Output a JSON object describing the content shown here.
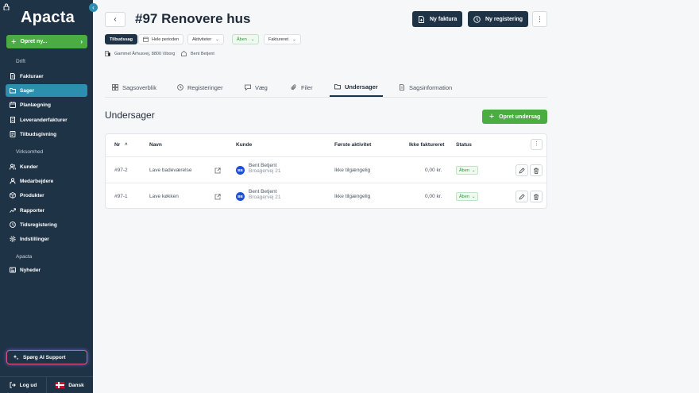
{
  "app": {
    "logo": "Apacta"
  },
  "sidebar": {
    "create_label": "Opret ny...",
    "sections": [
      {
        "label": "Drift",
        "items": [
          {
            "label": "Fakturaer",
            "icon": "invoice-icon"
          },
          {
            "label": "Sager",
            "icon": "folder-icon",
            "active": true
          },
          {
            "label": "Planlægning",
            "icon": "calendar-icon"
          },
          {
            "label": "Leverandørfakturer",
            "icon": "supplier-invoice-icon"
          },
          {
            "label": "Tilbudsgivning",
            "icon": "quote-icon"
          }
        ]
      },
      {
        "label": "Virksomhed",
        "items": [
          {
            "label": "Kunder",
            "icon": "customers-icon"
          },
          {
            "label": "Medarbejdere",
            "icon": "employees-icon"
          },
          {
            "label": "Produkter",
            "icon": "box-icon"
          },
          {
            "label": "Rapporter",
            "icon": "chart-line-icon"
          },
          {
            "label": "Tidsregistering",
            "icon": "clock-icon"
          },
          {
            "label": "Indstillinger",
            "icon": "gear-icon"
          }
        ]
      },
      {
        "label": "Apacta",
        "items": [
          {
            "label": "Nyheder",
            "icon": "news-icon"
          }
        ]
      }
    ],
    "ai_support": "Spørg AI Support",
    "logout": "Log ud",
    "language": "Dansk"
  },
  "header": {
    "title": "#97 Renovere hus",
    "new_invoice": "Ny faktura",
    "new_registration": "Ny registering"
  },
  "filters": {
    "type_badge": "Tilbudssag",
    "period": "Hele perioden",
    "activities": "Aktiviteter",
    "status": "Åben",
    "invoiced": "Faktureret"
  },
  "meta": {
    "address": "Gammel Århusvej, 8800 Viborg",
    "customer": "Bent Betjent"
  },
  "tabs": [
    {
      "label": "Sagsoverblik",
      "icon": "overview-icon"
    },
    {
      "label": "Registeringer",
      "icon": "clock-icon"
    },
    {
      "label": "Væg",
      "icon": "chat-icon"
    },
    {
      "label": "Filer",
      "icon": "paperclip-icon"
    },
    {
      "label": "Undersager",
      "icon": "folder-icon",
      "active": true
    },
    {
      "label": "Sagsinformation",
      "icon": "document-icon"
    }
  ],
  "subcases": {
    "title": "Undersager",
    "create_label": "Opret undersag",
    "columns": {
      "nr": "Nr",
      "name": "Navn",
      "customer": "Kunde",
      "first_activity": "Første aktivitet",
      "not_invoiced": "Ikke faktureret",
      "status": "Status"
    },
    "rows": [
      {
        "nr": "#97-2",
        "name": "Lave badeværelse",
        "avatar": "BB",
        "customer": "Bent Betjent",
        "address": "Broagervej 21",
        "first_activity": "Ikke tilgængelig",
        "not_invoiced": "0,00 kr.",
        "status": "Åben"
      },
      {
        "nr": "#97-1",
        "name": "Lave køkken",
        "avatar": "BB",
        "customer": "Bent Betjent",
        "address": "Broagervej 21",
        "first_activity": "Ikke tilgængelig",
        "not_invoiced": "0,00 kr.",
        "status": "Åben"
      }
    ]
  }
}
